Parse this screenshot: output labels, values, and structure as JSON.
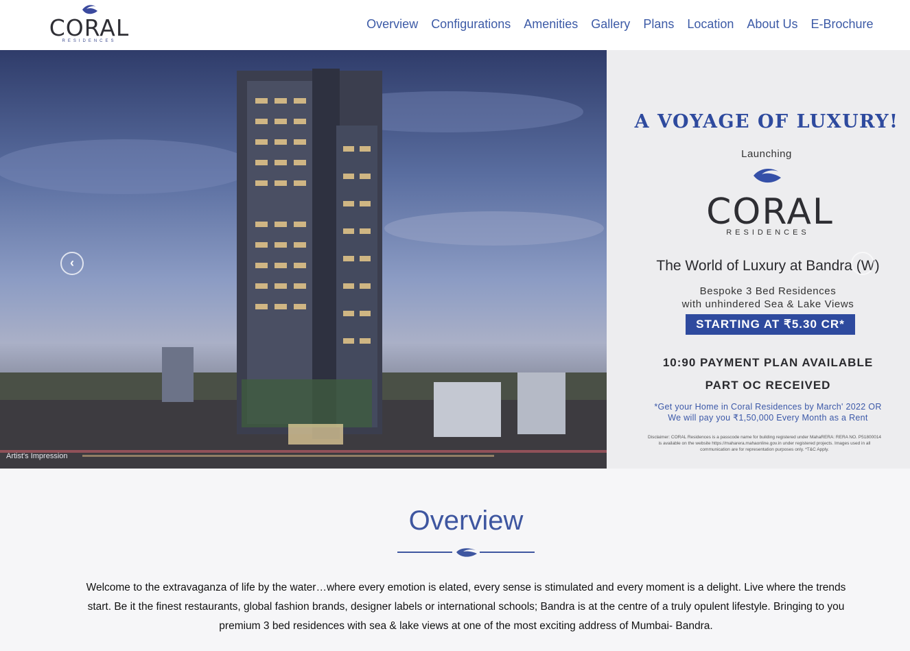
{
  "header": {
    "logo_text": "CORAL",
    "logo_sub": "RESIDENCES",
    "nav": [
      {
        "label": "Overview"
      },
      {
        "label": "Configurations"
      },
      {
        "label": "Amenities"
      },
      {
        "label": "Gallery"
      },
      {
        "label": "Plans"
      },
      {
        "label": "Location"
      },
      {
        "label": "About Us"
      },
      {
        "label": "E-Brochure"
      }
    ]
  },
  "hero": {
    "caption": "Artist's Impression",
    "prev_icon": "chevron-left-icon",
    "panel": {
      "tagline": "A VOYAGE OF LUXURY!",
      "launching": "Launching",
      "logo_text": "CORAL",
      "logo_sub": "RESIDENCES",
      "world": "The World of Luxury at Bandra (W)",
      "bespoke_line1": "Bespoke 3 Bed Residences",
      "bespoke_line2": "with unhindered Sea & Lake Views",
      "price": "STARTING AT ₹5.30 CR*",
      "plan": "10:90 PAYMENT PLAN AVAILABLE",
      "oc": "PART OC RECEIVED",
      "note_line1": "*Get your Home in Coral Residences by March' 2022 OR",
      "note_line2": "We will pay you ₹1,50,000 Every Month as a Rent",
      "disclaimer_line1": "Disclaimer: CORAL Residences is a passcode name for building registered under MahaRERA: RERA NO. P51800014",
      "disclaimer_line2": "is available on the website https://maharera.mahaonline.gov.in under registered projects. Images used in all",
      "disclaimer_line3": "communication are for representation purposes only. *T&C Apply."
    }
  },
  "overview": {
    "title": "Overview",
    "paragraph": "Welcome to the extravaganza of life by the water…where every emotion is elated, every sense is stimulated and every moment is a delight. Live where the trends start. Be it the finest restaurants, global fashion brands, designer labels or international schools; Bandra is at the centre of a truly opulent lifestyle. Bringing to you premium 3 bed residences with sea & lake views at one of the most exciting address of Mumbai- Bandra."
  },
  "colors": {
    "brand_blue": "#2e4a9e",
    "nav_blue": "#3c5aa6"
  }
}
